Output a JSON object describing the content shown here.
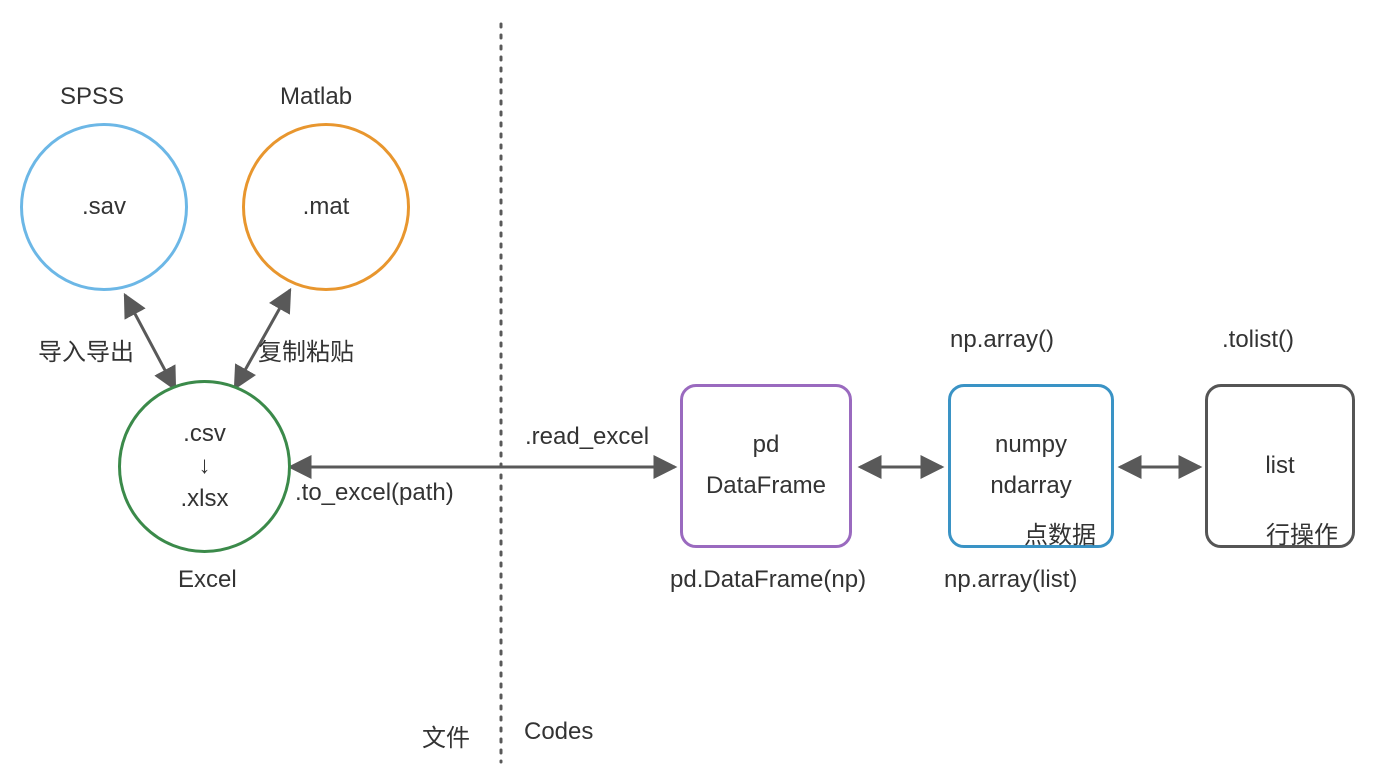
{
  "nodes": {
    "spss": {
      "title": "SPSS",
      "content": ".sav",
      "color": "#6cb7e6"
    },
    "matlab": {
      "title": "Matlab",
      "content": ".mat",
      "color": "#e8962e"
    },
    "excel": {
      "title": "Excel",
      "line1": ".csv",
      "arrow": "↓",
      "line2": ".xlsx",
      "color": "#3b8a4a"
    },
    "pd": {
      "line1": "pd",
      "line2": "DataFrame",
      "color": "#9a6abf",
      "subtitle": "pd.DataFrame(np)"
    },
    "numpy": {
      "line1": "numpy",
      "line2": "ndarray",
      "color": "#3a93c5",
      "subtitle": "np.array(list)",
      "tag": "点数据"
    },
    "list": {
      "line1": "list",
      "color": "#555555",
      "tag": "行操作"
    }
  },
  "edges": {
    "spss_excel": "导入导出",
    "matlab_excel": "复制粘贴",
    "excel_pd_top": ".read_excel",
    "excel_pd_bottom": ".to_excel(path)",
    "pd_numpy_top": "np.array()",
    "numpy_list_top": ".tolist()"
  },
  "sections": {
    "left": "文件",
    "right": "Codes"
  },
  "colors": {
    "arrow": "#595959",
    "text": "#333333"
  }
}
